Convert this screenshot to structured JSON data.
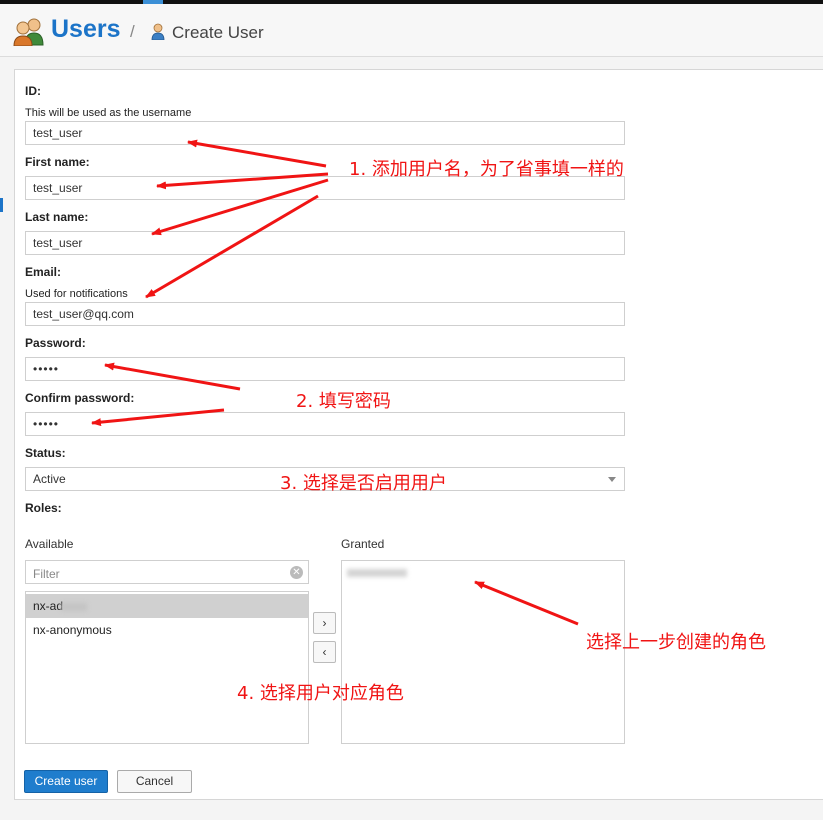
{
  "header": {
    "title": "Users",
    "separator": "/",
    "breadcrumb": "Create User"
  },
  "form": {
    "id_label": "ID:",
    "id_hint": "This will be used as the username",
    "id_value": "test_user",
    "first_name_label": "First name:",
    "first_name_value": "test_user",
    "last_name_label": "Last name:",
    "last_name_value": "test_user",
    "email_label": "Email:",
    "email_hint": "Used for notifications",
    "email_value": "test_user@qq.com",
    "password_label": "Password:",
    "password_value": "•••••",
    "confirm_label": "Confirm password:",
    "confirm_value": "•••••",
    "status_label": "Status:",
    "status_value": "Active",
    "roles_label": "Roles:"
  },
  "roles": {
    "available_label": "Available",
    "granted_label": "Granted",
    "filter_placeholder": "Filter",
    "available_items": [
      "nx-ad",
      "nx-anonymous"
    ],
    "move_right": "›",
    "move_left": "‹",
    "clear_glyph": "✕"
  },
  "buttons": {
    "create": "Create user",
    "cancel": "Cancel"
  },
  "annotations": {
    "step1": "1. 添加用户名，为了省事填一样的",
    "step2": "2. 填写密码",
    "step3": "3. 选择是否启用用户",
    "step4": "4. 选择用户对应角色",
    "granted_note": "选择上一步创建的角色"
  },
  "colors": {
    "brand": "#1c74c8",
    "annotation": "#f01414",
    "primary_button": "#1f7dcd"
  },
  "icons": {
    "users": "users-icon",
    "user": "user-icon",
    "clear": "clear-icon",
    "dropdown": "chevron-down-icon"
  }
}
